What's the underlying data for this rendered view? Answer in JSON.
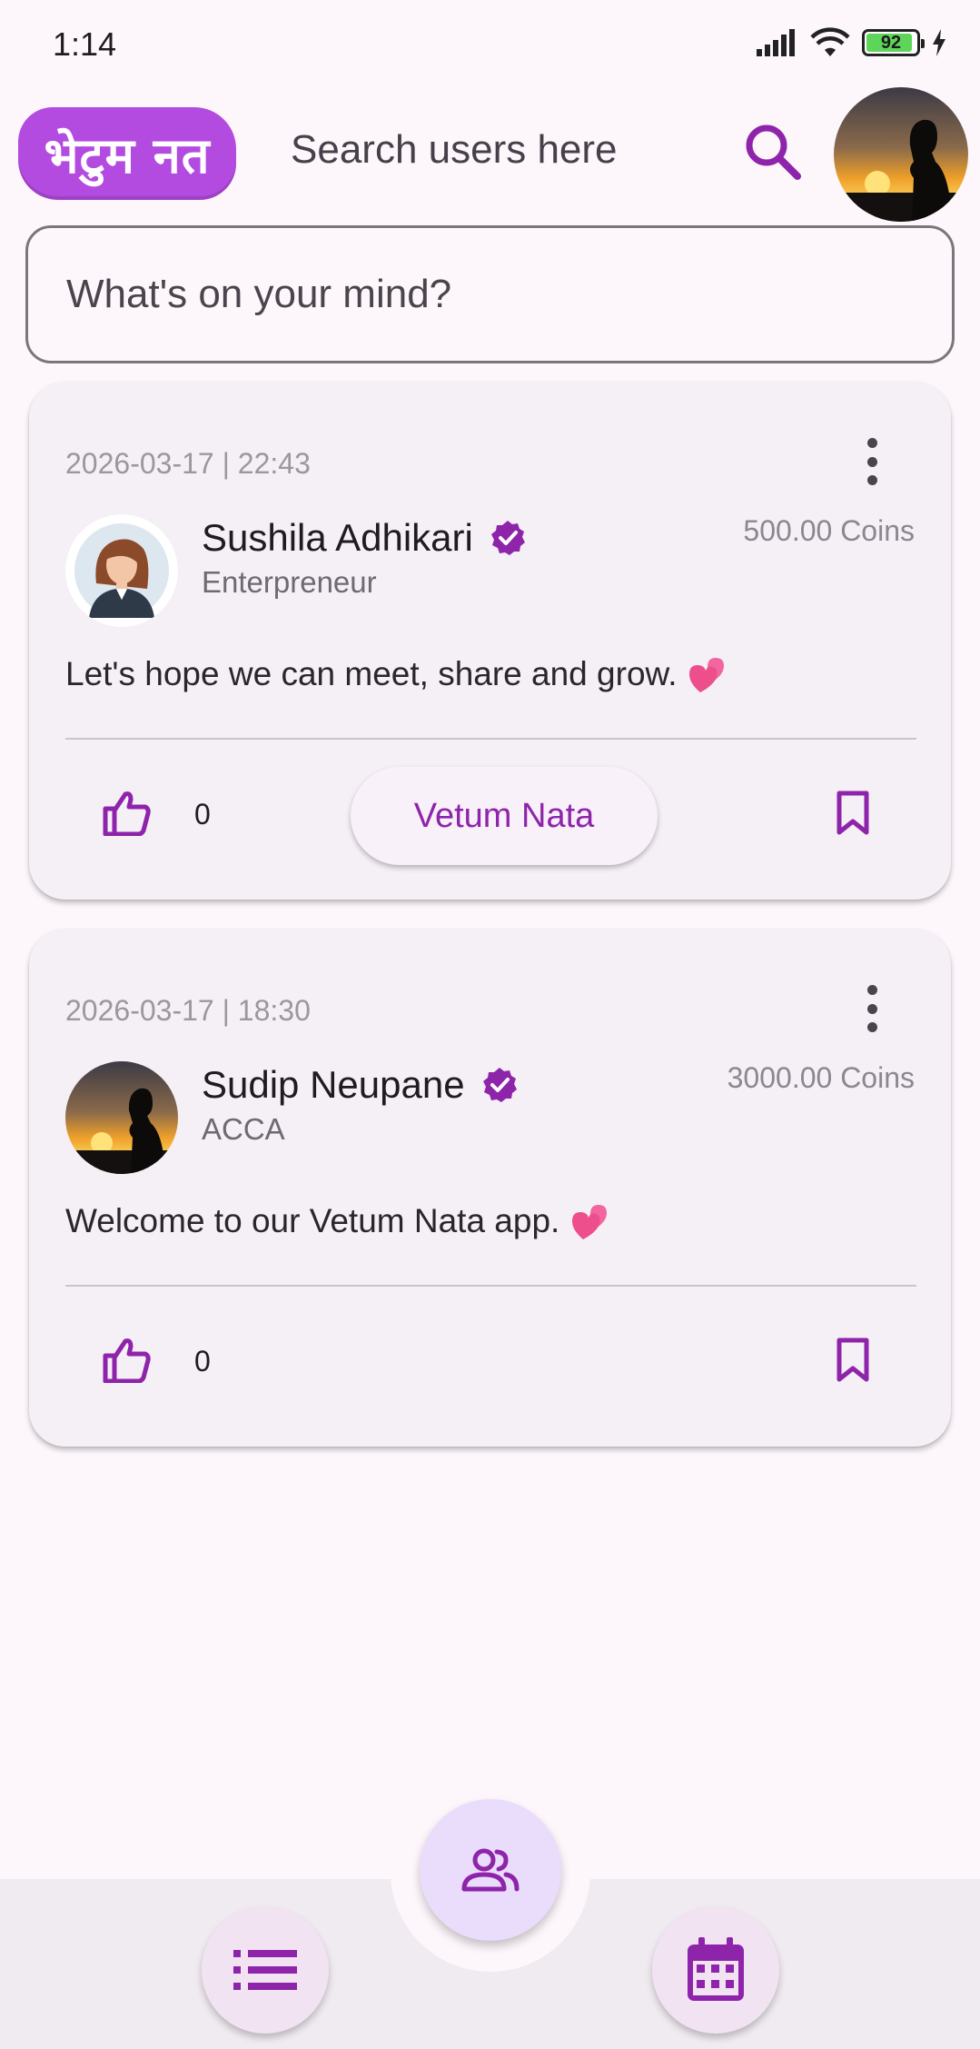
{
  "status_bar": {
    "time": "1:14",
    "battery_level": "92",
    "battery_fraction": 0.92
  },
  "header": {
    "logo_text": "भेटुम नत",
    "search_placeholder": "Search users here",
    "search_icon": "search-icon",
    "profile_avatar": "profile-avatar"
  },
  "composer": {
    "placeholder": "What's on your mind?"
  },
  "posts": [
    {
      "date": "2026-03-17 | 22:43",
      "author": "Sushila Adhikari",
      "role": "Enterpreneur",
      "coins": "500.00 Coins",
      "text": "Let's hope we can meet, share and grow.",
      "emoji": "💕",
      "likes": "0",
      "action_label": "Vetum Nata",
      "verified": true
    },
    {
      "date": "2026-03-17 | 18:30",
      "author": "Sudip Neupane",
      "role": "ACCA",
      "coins": "3000.00 Coins",
      "text": "Welcome to our Vetum Nata app.",
      "emoji": "💕",
      "likes": "0",
      "verified": true
    }
  ],
  "bottom_nav": {
    "left_icon": "list-icon",
    "center_icon": "people-icon",
    "right_icon": "calendar-icon"
  },
  "colors": {
    "accent": "#8e24aa",
    "logo_bg": "#b44be0",
    "background": "#fdf7fc"
  }
}
